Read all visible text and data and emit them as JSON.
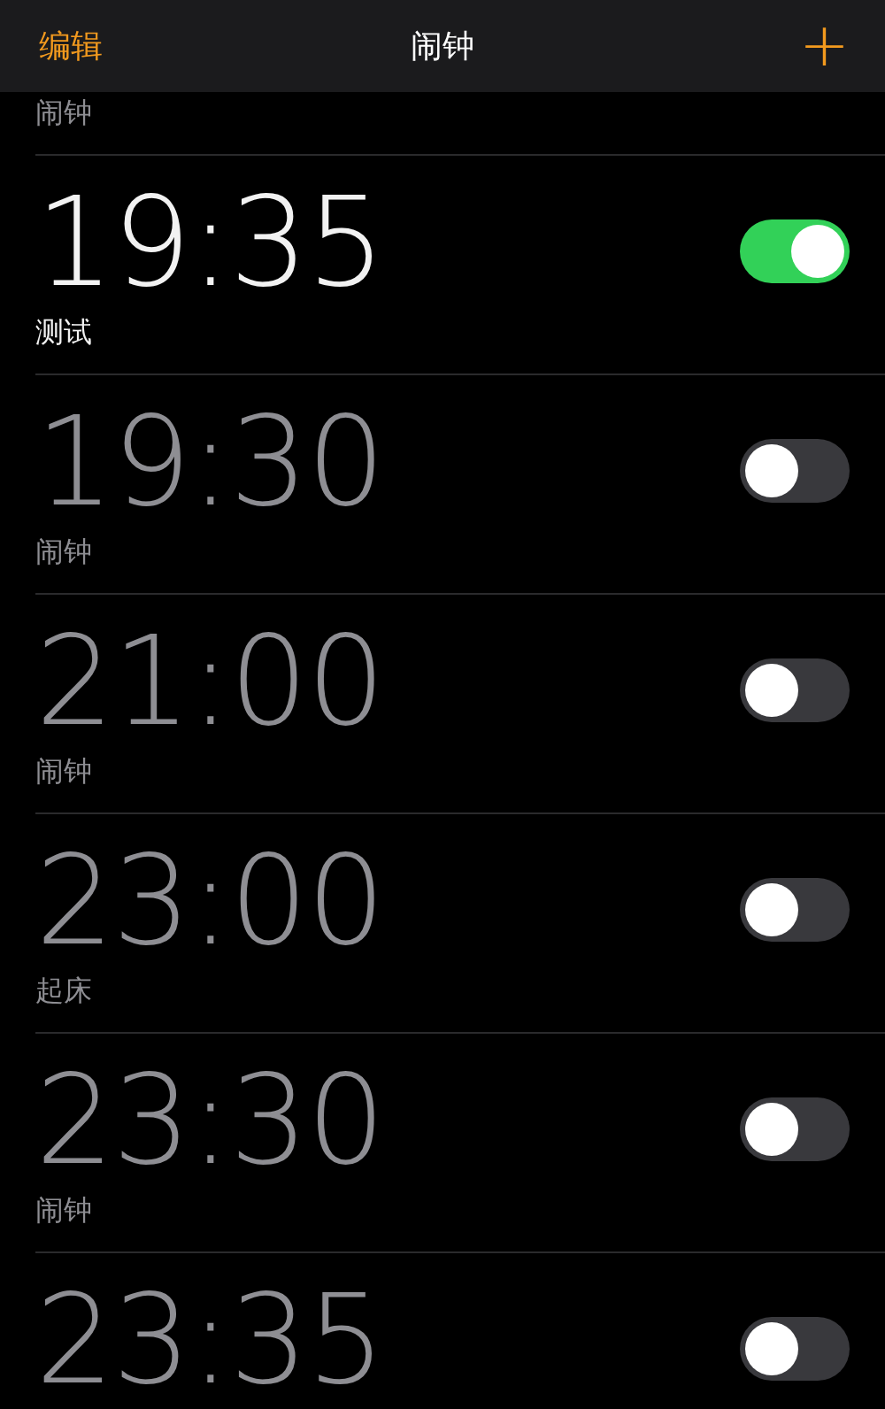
{
  "nav": {
    "edit": "编辑",
    "title": "闹钟",
    "add": "+"
  },
  "partial_label": "闹钟",
  "alarms": [
    {
      "time": "19:35",
      "label": "测试",
      "on": true
    },
    {
      "time": "19:30",
      "label": "闹钟",
      "on": false
    },
    {
      "time": "21:00",
      "label": "闹钟",
      "on": false
    },
    {
      "time": "23:00",
      "label": "起床",
      "on": false
    },
    {
      "time": "23:30",
      "label": "闹钟",
      "on": false
    },
    {
      "time": "23:35",
      "on": false
    }
  ]
}
